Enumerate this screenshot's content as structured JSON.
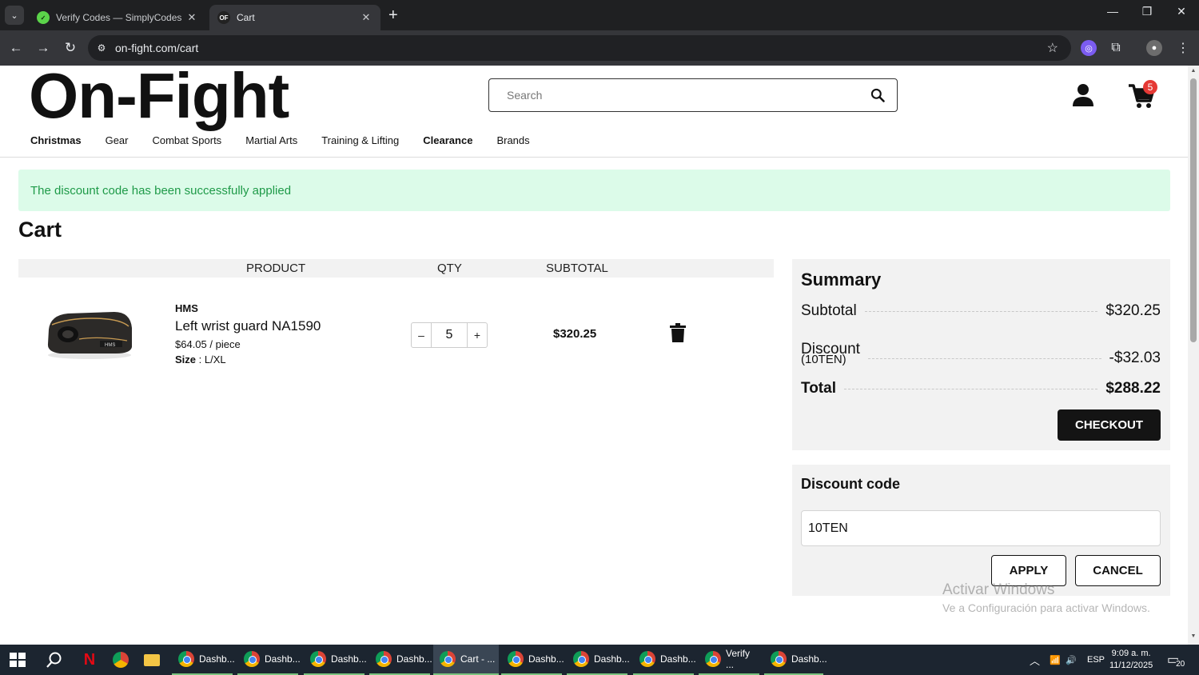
{
  "browser": {
    "tabs": [
      {
        "title": "Verify Codes — SimplyCodes",
        "favicon": "simplycodes-icon",
        "active": false
      },
      {
        "title": "Cart",
        "favicon": "on-fight-icon",
        "favicon_text": "OF",
        "active": true
      }
    ],
    "url": "on-fight.com/cart"
  },
  "site": {
    "logo": "On-Fight",
    "search_placeholder": "Search",
    "cart_count": "5",
    "categories": [
      "Christmas",
      "Gear",
      "Combat Sports",
      "Martial Arts",
      "Training & Lifting",
      "Clearance",
      "Brands"
    ]
  },
  "alert": "The discount code has been successfully applied",
  "cart": {
    "title": "Cart",
    "headers": {
      "product": "PRODUCT",
      "qty": "QTY",
      "subtotal": "SUBTOTAL"
    },
    "items": [
      {
        "brand": "HMS",
        "name": "Left wrist guard NA1590",
        "unit_price": "$64.05 / piece",
        "size_label": "Size",
        "size_value": " : L/XL",
        "qty": "5",
        "minus": "–",
        "plus": "+",
        "line_total": "$320.25"
      }
    ]
  },
  "summary": {
    "title": "Summary",
    "subtotal_label": "Subtotal",
    "subtotal_value": "$320.25",
    "discount_label": "Discount",
    "discount_code": "(10TEN)",
    "discount_value": "-$32.03",
    "total_label": "Total",
    "total_value": "$288.22",
    "checkout_label": "CHECKOUT"
  },
  "discount_form": {
    "title": "Discount code",
    "value": "10TEN",
    "apply_label": "APPLY",
    "cancel_label": "CANCEL"
  },
  "watermark": {
    "line1": "Activar Windows",
    "line2": "Ve a Configuración para activar Windows."
  },
  "taskbar": {
    "apps": [
      {
        "label": "Dashb...",
        "badge": "A"
      },
      {
        "label": "Dashb...",
        "badge": ""
      },
      {
        "label": "Dashb...",
        "badge": "N"
      },
      {
        "label": "Dashb...",
        "badge": "F"
      },
      {
        "label": "Cart - ...",
        "badge": ""
      },
      {
        "label": "Dashb...",
        "badge": ""
      },
      {
        "label": "Dashb...",
        "badge": ""
      },
      {
        "label": "Dashb...",
        "badge": "H"
      },
      {
        "label": "Verify ...",
        "badge": "J"
      },
      {
        "label": "Dashb...",
        "badge": "Y"
      }
    ],
    "language": "ESP",
    "time": "9:09 a. m.",
    "date": "11/12/2025",
    "notifications": "20"
  },
  "colors": {
    "alert_bg": "#dcfbe9",
    "alert_text": "#1e9a48",
    "badge_red": "#e53935",
    "checkout_bg": "#141414"
  }
}
